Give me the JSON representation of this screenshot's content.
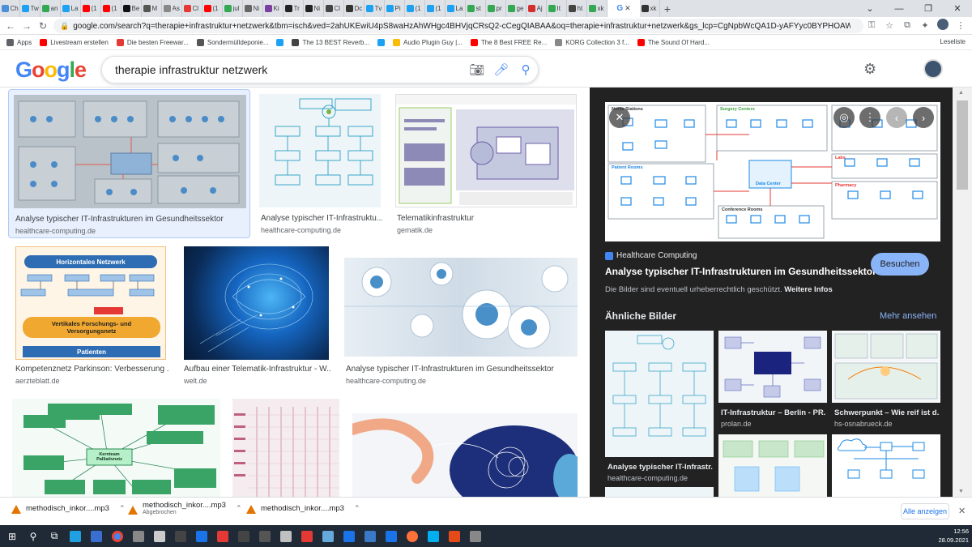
{
  "tabs": [
    {
      "label": "Ch",
      "color": "#4a90d9"
    },
    {
      "label": "Tw",
      "color": "#1da1f2"
    },
    {
      "label": "an",
      "color": "#34a853"
    },
    {
      "label": "La",
      "color": "#1da1f2"
    },
    {
      "label": "(1",
      "color": "#ff0000"
    },
    {
      "label": "(1",
      "color": "#ff0000"
    },
    {
      "label": "Be",
      "color": "#111111"
    },
    {
      "label": "M",
      "color": "#555555"
    },
    {
      "label": "As",
      "color": "#888888"
    },
    {
      "label": "Cl",
      "color": "#e53935"
    },
    {
      "label": "(1",
      "color": "#ff0000"
    },
    {
      "label": "jul",
      "color": "#34a853"
    },
    {
      "label": "Ni",
      "color": "#666666"
    },
    {
      "label": "Ki",
      "color": "#7b3fa0"
    },
    {
      "label": "Tr",
      "color": "#222222"
    },
    {
      "label": "Ni",
      "color": "#222222"
    },
    {
      "label": "Cl",
      "color": "#444444"
    },
    {
      "label": "Dc",
      "color": "#333333"
    },
    {
      "label": "Tv",
      "color": "#1da1f2"
    },
    {
      "label": "Pi",
      "color": "#1da1f2"
    },
    {
      "label": "(1",
      "color": "#1da1f2"
    },
    {
      "label": "(1",
      "color": "#1da1f2"
    },
    {
      "label": "La",
      "color": "#1da1f2"
    },
    {
      "label": "st",
      "color": "#34a853"
    },
    {
      "label": "pr",
      "color": "#34a853"
    },
    {
      "label": "ge",
      "color": "#34a853"
    },
    {
      "label": "Aj",
      "color": "#d32f2f"
    },
    {
      "label": "It",
      "color": "#34a853"
    },
    {
      "label": "ht",
      "color": "#444444"
    },
    {
      "label": "xk",
      "color": "#34a853"
    },
    {
      "label": "xk",
      "color": "#333333"
    }
  ],
  "active_tab": {
    "label": "G",
    "close": "✕"
  },
  "new_tab": "+",
  "window_controls": {
    "dropdown": "⌄",
    "minimize": "—",
    "maximize": "❐",
    "close": "✕"
  },
  "toolbar": {
    "back": "←",
    "forward": "→",
    "reload": "↻",
    "lock": "🔒",
    "url": "google.com/search?q=therapie+infrastruktur+netzwerk&tbm=isch&ved=2ahUKEwiU4pS8waHzAhWHgc4BHVjqCRsQ2-cCegQIABAA&oq=therapie+infrastruktur+netzwerk&gs_lcp=CgNpbWcQA1D-yAFYyc0BYPHOAWgAcAB4AYABbYgB2gSSAQM3LjGYAQCgA..."
  },
  "bookmarks": {
    "items": [
      {
        "label": "Apps",
        "color": "#5f6368"
      },
      {
        "label": "Livestream erstellen",
        "color": "#ff0000"
      },
      {
        "label": "Die besten Freewar...",
        "color": "#e53935"
      },
      {
        "label": "Sondermülldeponie...",
        "color": "#555555"
      },
      {
        "label": "",
        "color": "#1da1f2"
      },
      {
        "label": "The 13 BEST Reverb...",
        "color": "#444444"
      },
      {
        "label": "",
        "color": "#1da1f2"
      },
      {
        "label": "Audio Plugin Guy |...",
        "color": "#fbbc05"
      },
      {
        "label": "The 8 Best FREE Re...",
        "color": "#ff0000"
      },
      {
        "label": "KORG Collection 3 f...",
        "color": "#888888"
      },
      {
        "label": "The Sound Of Hard...",
        "color": "#ff0000"
      }
    ],
    "reading_list": "Leseliste"
  },
  "google": {
    "logo_letters": [
      {
        "l": "G",
        "c": "#4285f4"
      },
      {
        "l": "o",
        "c": "#ea4335"
      },
      {
        "l": "o",
        "c": "#fbbc05"
      },
      {
        "l": "g",
        "c": "#4285f4"
      },
      {
        "l": "l",
        "c": "#34a853"
      },
      {
        "l": "e",
        "c": "#ea4335"
      }
    ],
    "query": "therapie infrastruktur netzwerk"
  },
  "results": [
    {
      "title": "Analyse typischer IT-Infrastrukturen im Gesundheitssektor",
      "source": "healthcare-computing.de",
      "bg": "#b9c2c9",
      "accent": "#3c8fd6"
    },
    {
      "title": "Analyse typischer IT-Infrastruktu...",
      "source": "healthcare-computing.de",
      "bg": "#eef5f8",
      "accent": "#3aa6c8"
    },
    {
      "title": "Telematikinfrastruktur",
      "source": "gematik.de",
      "bg": "#dde0ec",
      "accent": "#6c5fa8"
    },
    {
      "title": "Kompetenznetz Parkinson: Verbesserung ...",
      "source": "aerzteblatt.de",
      "bg": "#fff5e6",
      "accent": "#2e6db4"
    },
    {
      "title": "Aufbau einer Telematik-Infrastruktur - W...",
      "source": "welt.de",
      "bg": "#0a3a6b",
      "accent": "#4db6f5"
    },
    {
      "title": "Analyse typischer IT-Infrastrukturen im Gesundheitssektor",
      "source": "healthcare-computing.de",
      "bg": "#dde7ef",
      "accent": "#4a90c8"
    },
    {
      "title": "",
      "source": "",
      "bg": "#f4faf6",
      "accent": "#2e8b57"
    },
    {
      "title": "",
      "source": "",
      "bg": "#f5ecef",
      "accent": "#c06080"
    },
    {
      "title": "",
      "source": "",
      "bg": "#f3f5f8",
      "accent": "#1d2f7a"
    }
  ],
  "thumb_labels": {
    "horizontal": "Horizontales Netzwerk",
    "vertical": "Vertikales Forschungs- und Versorgungsnetz",
    "patients": "Patienten",
    "kernteam": "Kernteam Palliativnetz"
  },
  "panel": {
    "source": "Healthcare Computing",
    "title": "Analyse typischer IT-Infrastrukturen im Gesundheitssektor",
    "visit": "Besuchen",
    "copyright": "Die Bilder sind eventuell urheberrechtlich geschützt.",
    "more_info": "Weitere Infos",
    "similar_heading": "Ähnliche Bilder",
    "see_more": "Mehr ansehen",
    "btn_close": "✕",
    "btn_lens": "◎",
    "btn_more": "⋮",
    "btn_prev": "‹",
    "btn_next": "›",
    "diagram_labels": [
      "Nurse Stations",
      "Surgery Centers",
      "Patient Rooms",
      "Labs",
      "Pharmacy",
      "Conference Rooms",
      "Data Center"
    ],
    "similar": [
      {
        "title": "Analyse typischer IT-Infrastr...",
        "source": "healthcare-computing.de"
      },
      {
        "title": "IT-Infrastruktur – Berlin - PR...",
        "source": "prolan.de"
      },
      {
        "title": "Schwerpunkt – Wie reif ist d...",
        "source": "hs-osnabrueck.de"
      }
    ]
  },
  "downloads": {
    "items": [
      {
        "name": "methodisch_inkor....mp3",
        "sub": ""
      },
      {
        "name": "methodisch_inkor....mp3",
        "sub": "Abgebrochen"
      },
      {
        "name": "methodisch_inkor....mp3",
        "sub": ""
      }
    ],
    "show_all": "Alle anzeigen",
    "close": "✕"
  },
  "taskbar": {
    "start": "⊞",
    "search": "⚲",
    "task_view": "⧉",
    "apps": [
      {
        "name": "edge",
        "color": "#1fa0e0"
      },
      {
        "name": "mail",
        "color": "#3a6fd0"
      },
      {
        "name": "chrome",
        "color": "#fbbc05"
      },
      {
        "name": "tool",
        "color": "#888888"
      },
      {
        "name": "unity",
        "color": "#cccccc"
      },
      {
        "name": "live",
        "color": "#444444"
      },
      {
        "name": "app",
        "color": "#1a73e8"
      },
      {
        "name": "audio",
        "color": "#e53935"
      },
      {
        "name": "cubase",
        "color": "#444444"
      },
      {
        "name": "kali",
        "color": "#555555"
      },
      {
        "name": "x",
        "color": "#c0c0c0"
      },
      {
        "name": "deezer",
        "color": "#e53935"
      },
      {
        "name": "app2",
        "color": "#66aadd"
      },
      {
        "name": "app3",
        "color": "#1a73e8"
      },
      {
        "name": "vbox",
        "color": "#3a78c8"
      },
      {
        "name": "screen",
        "color": "#1a73e8"
      },
      {
        "name": "firefox",
        "color": "#ff7139"
      },
      {
        "name": "skype",
        "color": "#00aff0"
      },
      {
        "name": "app4",
        "color": "#e64a19"
      },
      {
        "name": "app5",
        "color": "#888888"
      }
    ],
    "time": "12:56",
    "date": "28.09.2021"
  }
}
